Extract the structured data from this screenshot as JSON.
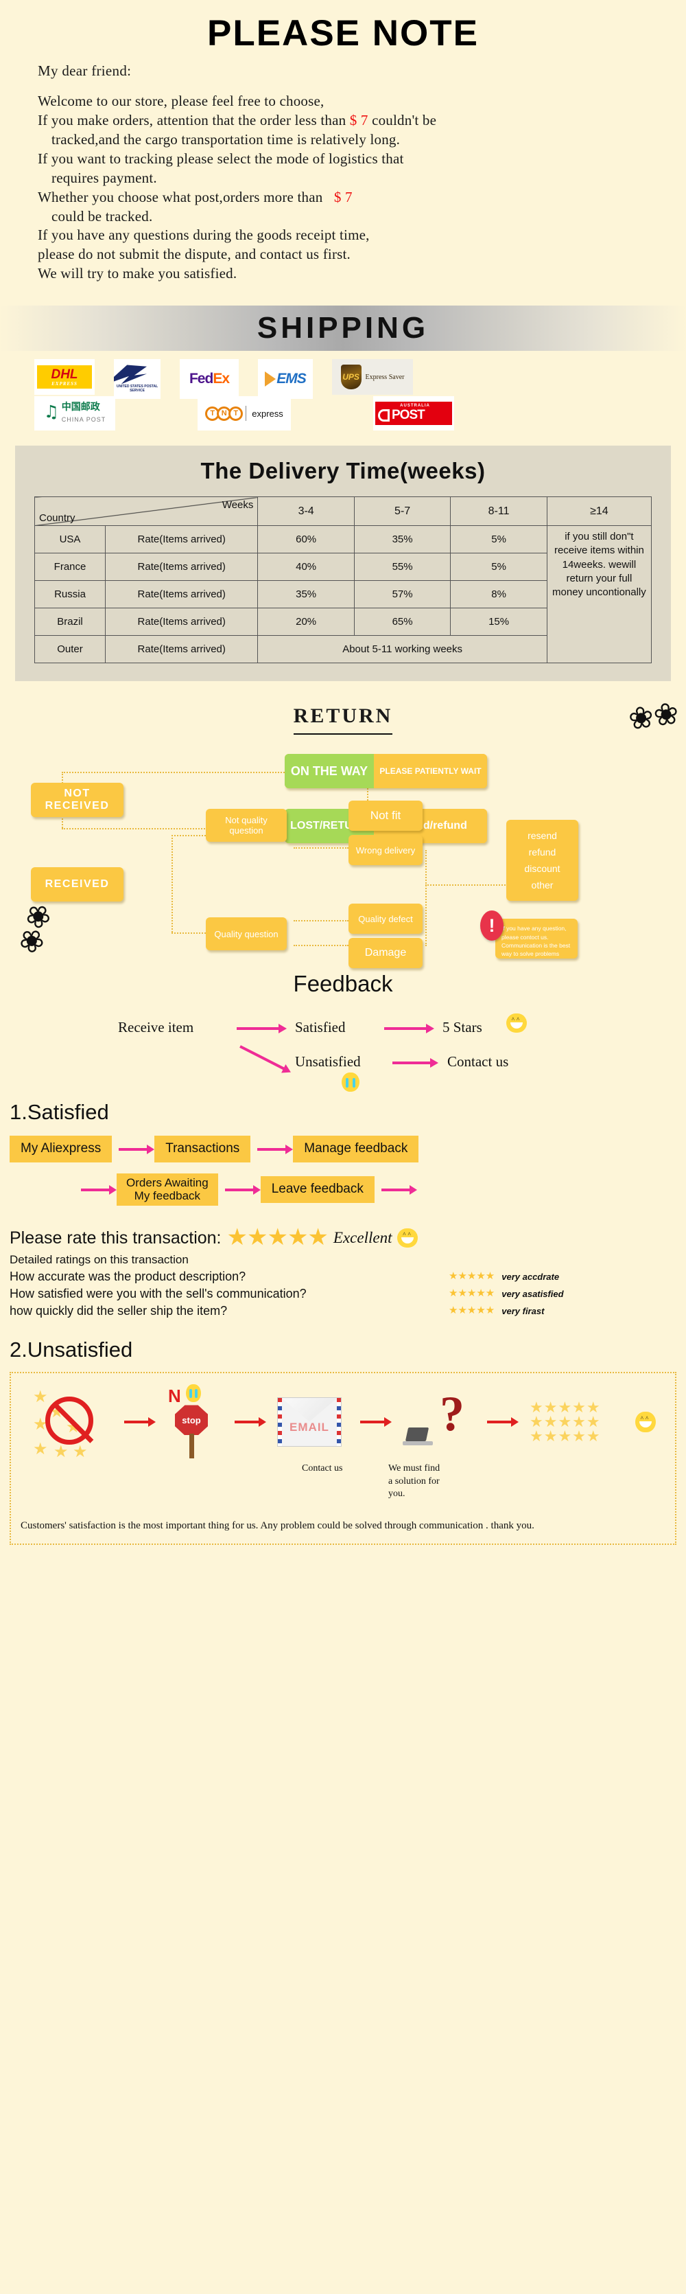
{
  "note": {
    "title": "PLEASE NOTE",
    "greeting": "My dear friend:",
    "lines": [
      {
        "text": "Welcome to our store, please feel free to choose,",
        "indent": false
      },
      {
        "pre": "If you make orders, attention that the order less than ",
        "money": "$ 7",
        "post": " couldn't be",
        "indent": false
      },
      {
        "text": "tracked,and the cargo transportation time is relatively long.",
        "indent": true
      },
      {
        "text": "If you want to tracking please select the mode of logistics that",
        "indent": false
      },
      {
        "text": "requires payment.",
        "indent": true
      },
      {
        "pre": "Whether you choose what post,orders more than   ",
        "money": "$ 7",
        "post": "",
        "indent": false
      },
      {
        "text": "could be tracked.",
        "indent": true
      },
      {
        "text": "If you have any questions during the goods receipt time,",
        "indent": false
      },
      {
        "text": "please do not submit the dispute, and contact us first.",
        "indent": false
      },
      {
        "text": "We will try to make you satisfied.",
        "indent": false
      }
    ],
    "money_color": "#ee1111"
  },
  "shipping": {
    "banner_title": "SHIPPING",
    "carriers_row1": [
      {
        "name": "DHL",
        "sub": "EXPRESS"
      },
      {
        "name": "USPS",
        "sub": "UNITED STATES POSTAL SERVICE"
      },
      {
        "name": "FedEx",
        "fed": "Fed",
        "ex": "Ex"
      },
      {
        "name": "EMS"
      },
      {
        "name": "UPS",
        "sub": "Express Saver"
      }
    ],
    "carriers_row2": [
      {
        "name": "CHINA POST",
        "cn": "中国邮政",
        "en": "CHINA POST"
      },
      {
        "name": "TNT express",
        "letters": [
          "T",
          "N",
          "T"
        ],
        "word": "express"
      },
      {
        "name": "AUSTRALIA POST",
        "top": "AUSTRALIA",
        "main": "POST"
      }
    ]
  },
  "delivery": {
    "title": "The Delivery Time(weeks)",
    "corner_weeks": "Weeks",
    "corner_country": "Country",
    "week_headers": [
      "3-4",
      "5-7",
      "8-11",
      "≥14"
    ],
    "rate_label": "Rate(Items arrived)",
    "rows": [
      {
        "country": "USA",
        "rate": "Rate(Items arrived)",
        "v1": "60%",
        "v2": "35%",
        "v3": "5%"
      },
      {
        "country": "France",
        "rate": "Rate(Items arrived)",
        "v1": "40%",
        "v2": "55%",
        "v3": "5%"
      },
      {
        "country": "Russia",
        "rate": "Rate(Items arrived)",
        "v1": "35%",
        "v2": "57%",
        "v3": "8%"
      },
      {
        "country": "Brazil",
        "rate": "Rate(Items arrived)",
        "v1": "20%",
        "v2": "65%",
        "v3": "15%"
      }
    ],
    "outer": {
      "country": "Outer",
      "rate": "Rate(Items arrived)",
      "span_text": "About 5-11 working weeks"
    },
    "side_note": "if you still don\"t receive items within 14weeks. wewill return your full money uncontionally"
  },
  "return": {
    "title": "RETURN",
    "not_received": "NOT RECEIVED",
    "received": "RECEIVED",
    "on_the_way": "ON THE WAY",
    "on_the_way_action": "PLEASE PATIENTLY WAIT",
    "lost_return": "LOST/RETURN",
    "lost_return_action": "resend/refund",
    "not_quality_question": "Not quality\nquestion",
    "quality_question": "Quality question",
    "not_fit": "Not fit",
    "wrong_delivery": "Wrong delivery",
    "quality_defect": "Quality defect",
    "damage": "Damage",
    "outcomes": [
      "resend",
      "refund",
      "discount",
      "other"
    ],
    "exclamation": "!",
    "note_card": "If you have any question, please contoct us. Communication is the best way to solve problems",
    "colors": {
      "green": "#a6d957",
      "yellow": "#fbc843",
      "red": "#e8334a",
      "dotted": "#e8b93f"
    }
  },
  "feedback": {
    "title": "Feedback",
    "receive_item": "Receive item",
    "satisfied": "Satisfied",
    "five_stars": "5 Stars",
    "unsatisfied": "Unsatisfied",
    "contact_us": "Contact us"
  },
  "satisfied": {
    "heading": "1.Satisfied",
    "row1": [
      "My Aliexpress",
      "Transactions",
      "Manage feedback"
    ],
    "row2": [
      "Orders Awaiting\nMy feedback",
      "Leave feedback"
    ]
  },
  "rate": {
    "question": "Please rate this transaction:",
    "stars": "★★★★★",
    "verdict": "Excellent",
    "subtitle": "Detailed ratings on this transaction",
    "rows": [
      {
        "q": "How accurate was the product description?",
        "stars": "★★★★★",
        "a": "very accdrate"
      },
      {
        "q": "How satisfied were you with the sell's communication?",
        "stars": "★★★★★",
        "a": "very asatisfied"
      },
      {
        "q": "how quickly did the seller ship the item?",
        "stars": "★★★★★",
        "a": "very firast"
      }
    ]
  },
  "unsatisfied": {
    "heading": "2.Unsatisfied",
    "no_label": "N",
    "stop_label": "stop",
    "email_label": "EMAIL",
    "question_mark": "?",
    "caption_contact": "Contact us",
    "caption_solution": "We must find\na solution for\nyou.",
    "footer": "Customers' satisfaction is the most important thing for us. Any problem could be solved through communication . thank you."
  }
}
